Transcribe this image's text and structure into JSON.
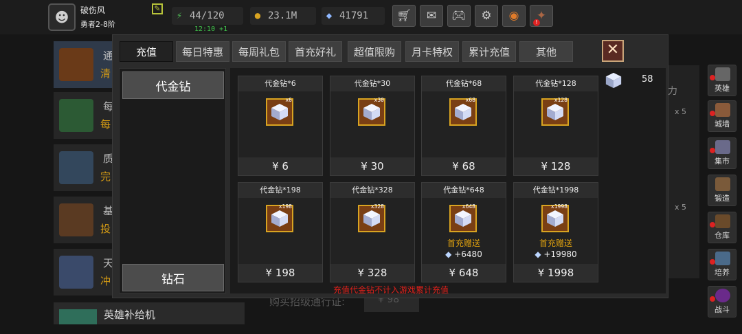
{
  "player": {
    "name": "破伤风",
    "rank": "勇者2-8阶"
  },
  "stats": {
    "stamina": "44/120",
    "stamina_timer": "12:10 +1",
    "gold": "23.1M",
    "gems": "41791"
  },
  "toolbar_icons": [
    "shop-cart-icon",
    "mail-icon",
    "gamepad-icon",
    "gear-icon",
    "color-wheel-icon",
    "event-icon"
  ],
  "background": {
    "list": [
      {
        "t1": "通",
        "t2": "清"
      },
      {
        "t1": "每",
        "t2": "每"
      },
      {
        "t1": "质",
        "t2": "完"
      },
      {
        "t1": "基",
        "t2": "投"
      },
      {
        "t1": "天",
        "t2": "冲"
      }
    ],
    "bottom_item": "英雄补给机",
    "bottom_mid": "购买招级通行证:",
    "bottom_mid_price": "¥ 98",
    "right_text": "力",
    "x5": "x 5"
  },
  "sidebar": [
    {
      "label": "英雄"
    },
    {
      "label": "城墙"
    },
    {
      "label": "集市"
    },
    {
      "label": "锻造"
    },
    {
      "label": "仓库"
    },
    {
      "label": "培养"
    },
    {
      "label": "战斗"
    }
  ],
  "modal": {
    "tabs": [
      "充值",
      "每日特惠",
      "每周礼包",
      "首充好礼",
      "超值限购",
      "月卡特权",
      "累计充值",
      "其他"
    ],
    "active_tab": 0,
    "categories": [
      "代金钻",
      "钻石"
    ],
    "balance": "58",
    "products": [
      {
        "name": "代金钻*6",
        "qty": "x6",
        "price": "¥ 6"
      },
      {
        "name": "代金钻*30",
        "qty": "x30",
        "price": "¥ 30"
      },
      {
        "name": "代金钻*68",
        "qty": "x68",
        "price": "¥ 68"
      },
      {
        "name": "代金钻*128",
        "qty": "x128",
        "price": "¥ 128"
      },
      {
        "name": "代金钻*198",
        "qty": "x198",
        "price": "¥ 198"
      },
      {
        "name": "代金钻*328",
        "qty": "x328",
        "price": "¥ 328"
      },
      {
        "name": "代金钻*648",
        "qty": "x648",
        "price": "¥ 648",
        "bonus_label": "首充赠送",
        "bonus_amount": "+6480"
      },
      {
        "name": "代金钻*1998",
        "qty": "x1998",
        "price": "¥ 1998",
        "bonus_label": "首充赠送",
        "bonus_amount": "+19980"
      }
    ],
    "notice": "充值代金钻不计入游戏累计充值"
  },
  "colors": {
    "accent_gold": "#e1a20f",
    "notice_red": "#e0201a",
    "timer_green": "#3fbf4a"
  }
}
